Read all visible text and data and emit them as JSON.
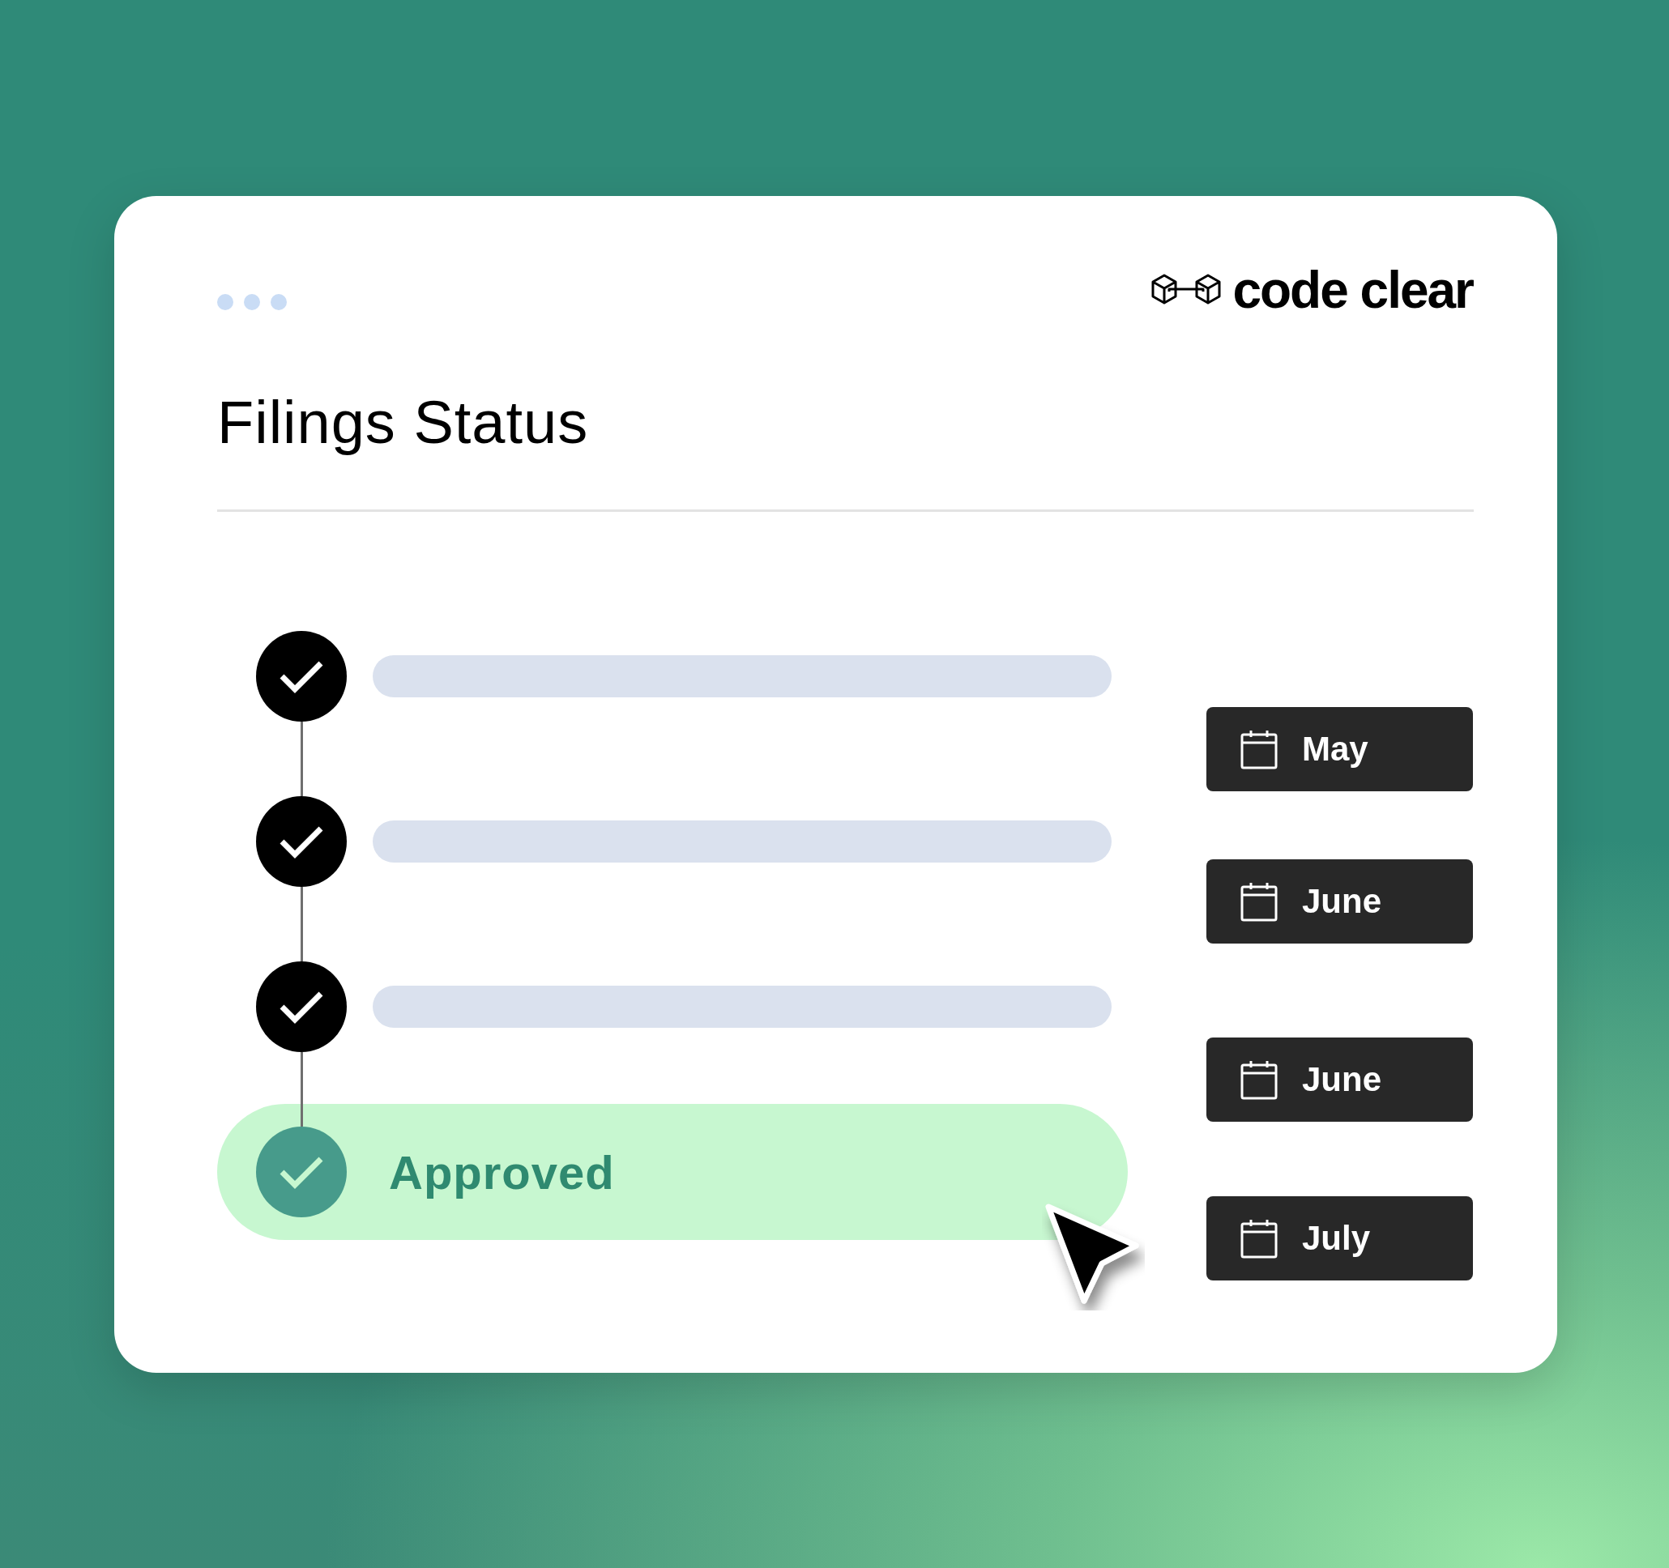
{
  "brand": {
    "name": "code clear"
  },
  "title": "Filings Status",
  "steps": [
    {
      "kind": "bar",
      "done": true
    },
    {
      "kind": "bar",
      "done": true
    },
    {
      "kind": "bar",
      "done": true
    },
    {
      "kind": "status",
      "done": true,
      "label": "Approved"
    }
  ],
  "dates": [
    {
      "label": "May"
    },
    {
      "label": "June"
    },
    {
      "label": "June"
    },
    {
      "label": "July"
    }
  ]
}
